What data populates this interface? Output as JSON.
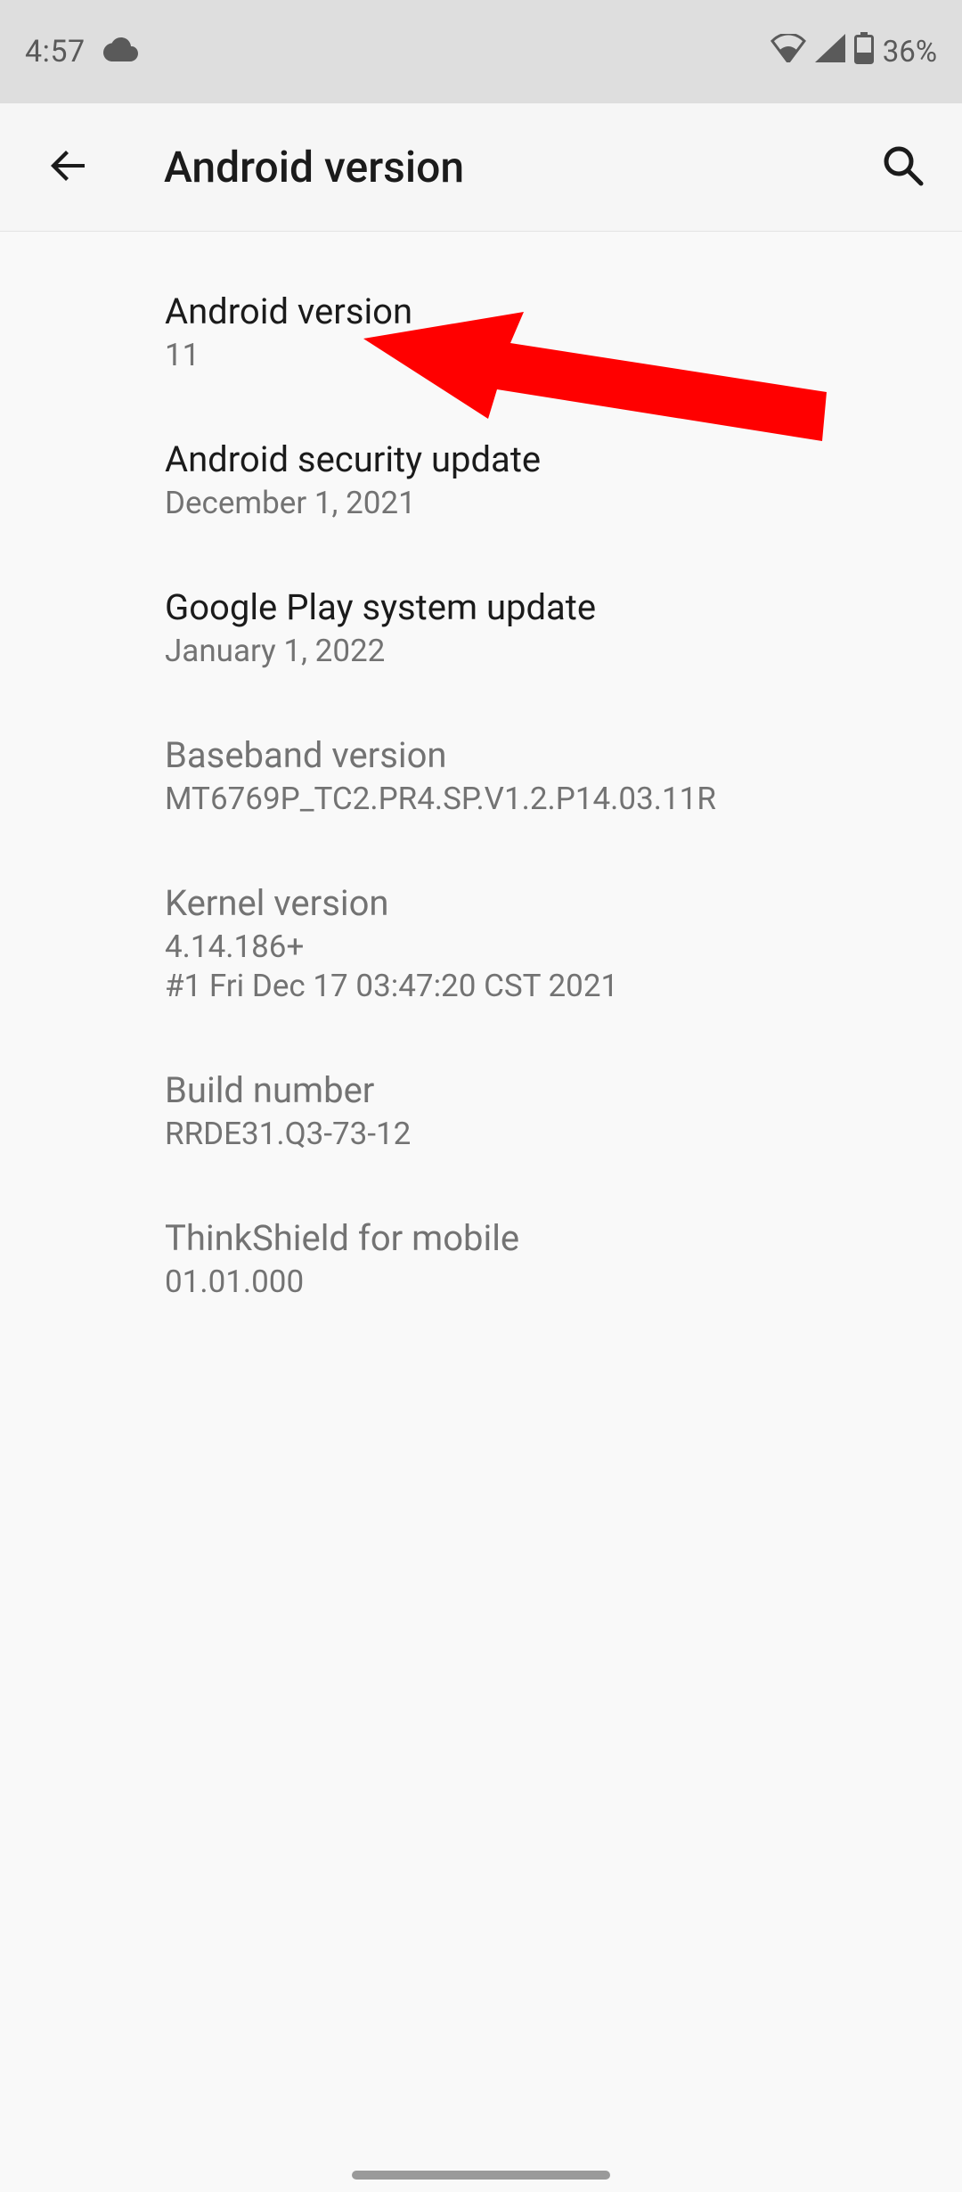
{
  "status_bar": {
    "time": "4:57",
    "battery_pct": "36%"
  },
  "header": {
    "title": "Android version"
  },
  "items": [
    {
      "title": "Android version",
      "subtitle": "11",
      "active": true
    },
    {
      "title": "Android security update",
      "subtitle": "December 1, 2021",
      "active": true
    },
    {
      "title": "Google Play system update",
      "subtitle": "January 1, 2022",
      "active": true
    },
    {
      "title": "Baseband version",
      "subtitle": "MT6769P_TC2.PR4.SP.V1.2.P14.03.11R",
      "active": false
    },
    {
      "title": "Kernel version",
      "subtitle": "4.14.186+\n#1 Fri Dec 17 03:47:20 CST 2021",
      "active": false
    },
    {
      "title": "Build number",
      "subtitle": "RRDE31.Q3-73-12",
      "active": false
    },
    {
      "title": "ThinkShield for mobile",
      "subtitle": "01.01.000",
      "active": false
    }
  ],
  "annotation": {
    "color": "#ff0000"
  }
}
